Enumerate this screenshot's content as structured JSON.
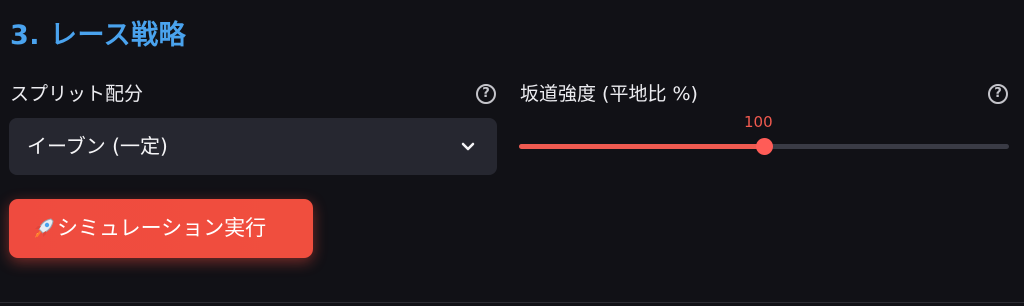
{
  "section": {
    "title": "3. レース戦略"
  },
  "split": {
    "label": "スプリット配分",
    "help": "?",
    "selected": "イーブン (一定)"
  },
  "slope": {
    "label": "坂道強度 (平地比 %)",
    "help": "?",
    "value": "100",
    "fraction": 0.5
  },
  "run_button": {
    "label": "シミュレーション実行"
  },
  "colors": {
    "title": "#4aa3ee",
    "accent": "#ef5a50",
    "background": "#111116",
    "select_bg": "#262730"
  },
  "icons": {
    "help": "question-circle-icon",
    "dropdown": "chevron-down-icon",
    "button": "rocket-icon"
  }
}
